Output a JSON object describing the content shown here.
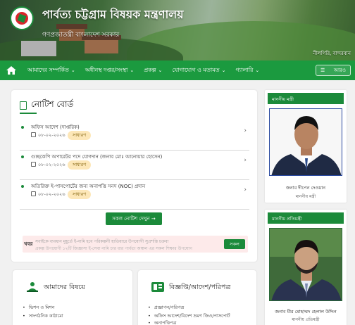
{
  "header": {
    "site_title": "পার্বত্য চট্টগ্রাম বিষয়ক মন্ত্রণালয়",
    "subtitle": "গণপ্রজাতন্ত্রী বাংলাদেশ সরকার",
    "banner_caption": "নীলগিরি, বান্দরবান"
  },
  "nav": {
    "items": [
      {
        "label": "আমাদের সম্পর্কিত"
      },
      {
        "label": "অধীনস্থ দপ্তর/সংস্থা"
      },
      {
        "label": "প্রকল্প"
      },
      {
        "label": "যোগাযোগ ও মতামত"
      },
      {
        "label": "গ্যালারি"
      }
    ],
    "search_label": "আরও"
  },
  "notice_board": {
    "title": "নোটিশ বোর্ড",
    "notices": [
      {
        "title": "অফিস আদেশ (দাপ্তরিক)",
        "date": "০৮-০২-২০২৬",
        "tag": "সাধারণ"
      },
      {
        "title": "গুচ্ছকেপি অপারেটর পদে যোগদান (জনাব মোঃ আনোয়ার হোসেন)",
        "date": "০৮-০২-২০২৬",
        "tag": "সাধারণ"
      },
      {
        "title": "অতিরিক্ত ই-পাসপোর্টের জন্য অনাপত্তি সনদ (NOC) প্রদান",
        "date": "০৮-০২-২০২৬",
        "tag": "সাধারণ"
      }
    ],
    "all_button": "সকল নোটিশ দেখুন →",
    "ticker_label": "খবর",
    "ticker_line1": "সবাইকে ব্যবধান মুহূর্তে ই-নামি হবে পরিকল্পনী হাতিয়ারে উপযোগী সুপ্রশস্তি চক্রবা",
    "ticker_line2": "প্রকল্প উপযোগী ১২টি জিজ্ঞাসা ই-সেবা নামি চার ধার পার্বত্য অঞ্চল এর সকল শিক্ষার উপযোগ",
    "ticker_button": "সকল"
  },
  "cards": [
    {
      "title": "আমাদের বিষয়ে",
      "items": [
        "ভিশন ও মিশন",
        "সাংগঠনিক কাঠামো"
      ]
    },
    {
      "title": "বিজ্ঞপ্তি/আদেশ/পরিপত্র",
      "items": [
        "প্রজ্ঞাপন/পরিপত্র",
        "অফিস আদেশ/বিদেশ ভ্রমণ জিও/পাসপোর্ট",
        "অনাপত্তিপত্র"
      ]
    }
  ],
  "sidebar": {
    "minister": {
      "header": "মাননীয় মন্ত্রী",
      "name": "জনাব দীপেন দেওয়ান",
      "role": "মাননীয় মন্ত্রী"
    },
    "state_minister": {
      "header": "মাননীয় প্রতিমন্ত্রী",
      "name": "জনাব মীর মোহাম্মদ হেলাল উদ্দিন",
      "role": "মাননীয় প্রতিমন্ত্রী"
    }
  },
  "colors": {
    "brand_green": "#1b8a3a",
    "nav_green": "#1b9a3f",
    "tag_bg": "#fde7b8",
    "ticker_bg": "#fdeaea"
  }
}
